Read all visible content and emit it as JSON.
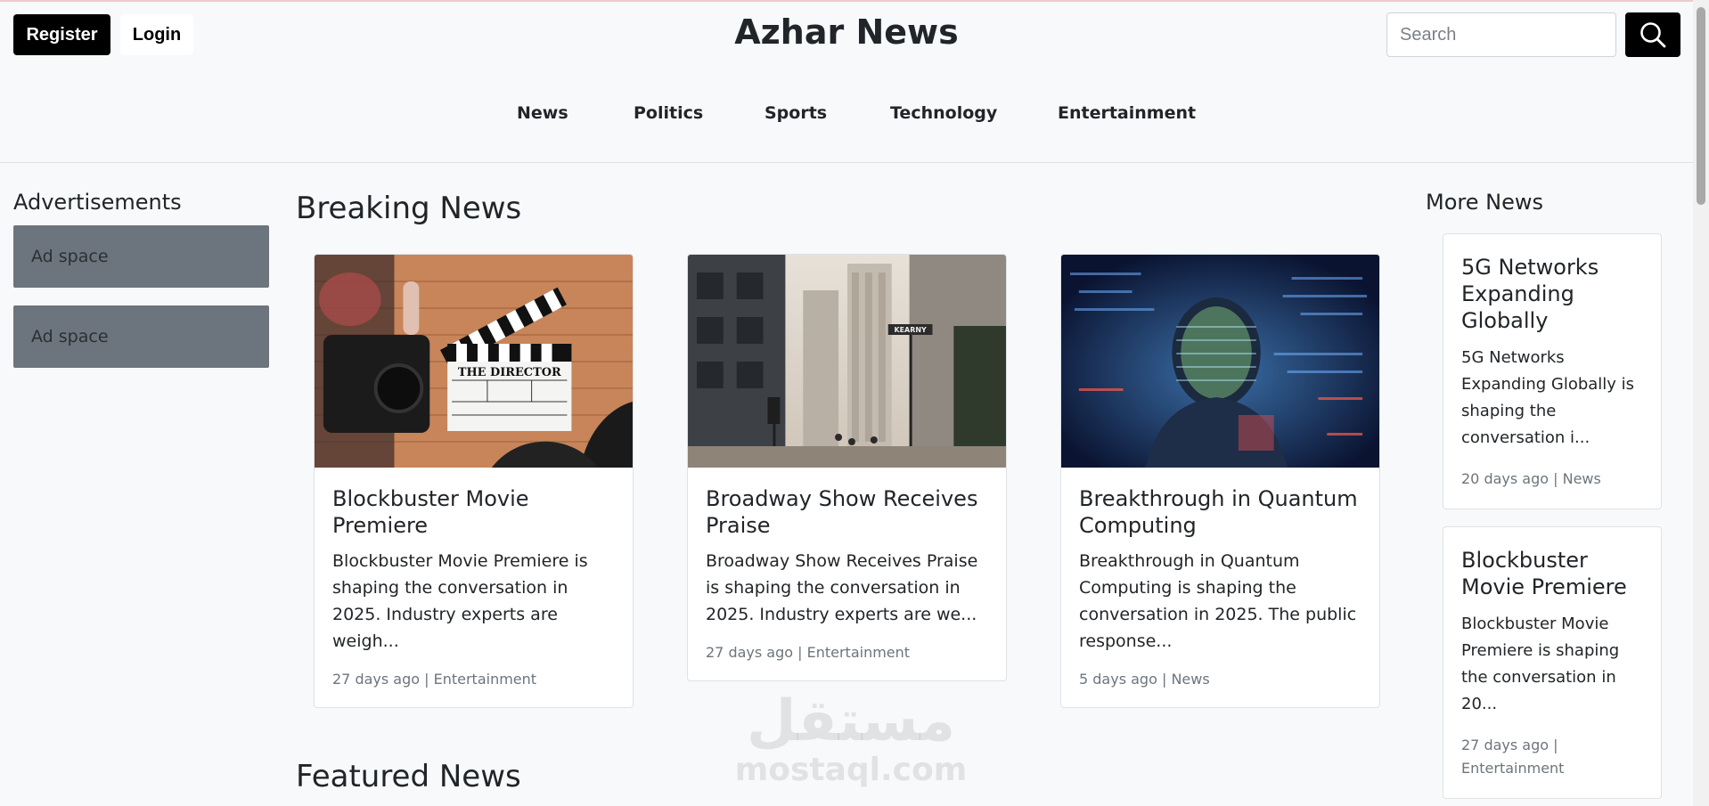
{
  "header": {
    "register_label": "Register",
    "login_label": "Login",
    "site_title": "Azhar News",
    "search_placeholder": "Search",
    "search_icon": "search-icon"
  },
  "nav": {
    "items": [
      {
        "label": "News"
      },
      {
        "label": "Politics"
      },
      {
        "label": "Sports"
      },
      {
        "label": "Technology"
      },
      {
        "label": "Entertainment"
      }
    ]
  },
  "sidebar_left": {
    "heading": "Advertisements",
    "ads": [
      {
        "label": "Ad space"
      },
      {
        "label": "Ad space"
      }
    ]
  },
  "main": {
    "breaking_heading": "Breaking News",
    "featured_heading": "Featured News",
    "cards": [
      {
        "title": "Blockbuster Movie Premiere",
        "excerpt": "Blockbuster Movie Premiere is shaping the conversation in 2025. Industry experts are weigh...",
        "age": "27 days ago",
        "category": "Entertainment",
        "image": "film-clapperboard-photo",
        "clapper_text": "THE DIRECTOR"
      },
      {
        "title": "Broadway Show Receives Praise",
        "excerpt": "Broadway Show Receives Praise is shaping the conversation in 2025. Industry experts are we...",
        "age": "27 days ago",
        "category": "Entertainment",
        "image": "city-street-photo",
        "sign_text": "KEARNY"
      },
      {
        "title": "Breakthrough in Quantum Computing",
        "excerpt": "Breakthrough in Quantum Computing is shaping the conversation in 2025. The public response...",
        "age": "5 days ago",
        "category": "News",
        "image": "digital-projection-portrait-photo"
      }
    ]
  },
  "sidebar_right": {
    "heading": "More News",
    "items": [
      {
        "title": "5G Networks Expanding Globally",
        "excerpt": "5G Networks Expanding Globally is shaping the conversation i...",
        "age": "20 days ago",
        "category": "News"
      },
      {
        "title": "Blockbuster Movie Premiere",
        "excerpt": "Blockbuster Movie Premiere is shaping the conversation in 20...",
        "age": "27 days ago",
        "category": "Entertainment"
      }
    ]
  },
  "watermark": {
    "arabic": "مستقل",
    "latin": "mostaql.com"
  },
  "colors": {
    "background": "#f8f9fa",
    "primary_button": "#000000",
    "ad_box": "#6c757d",
    "muted_text": "#6c757d",
    "border": "#dee2e6"
  }
}
